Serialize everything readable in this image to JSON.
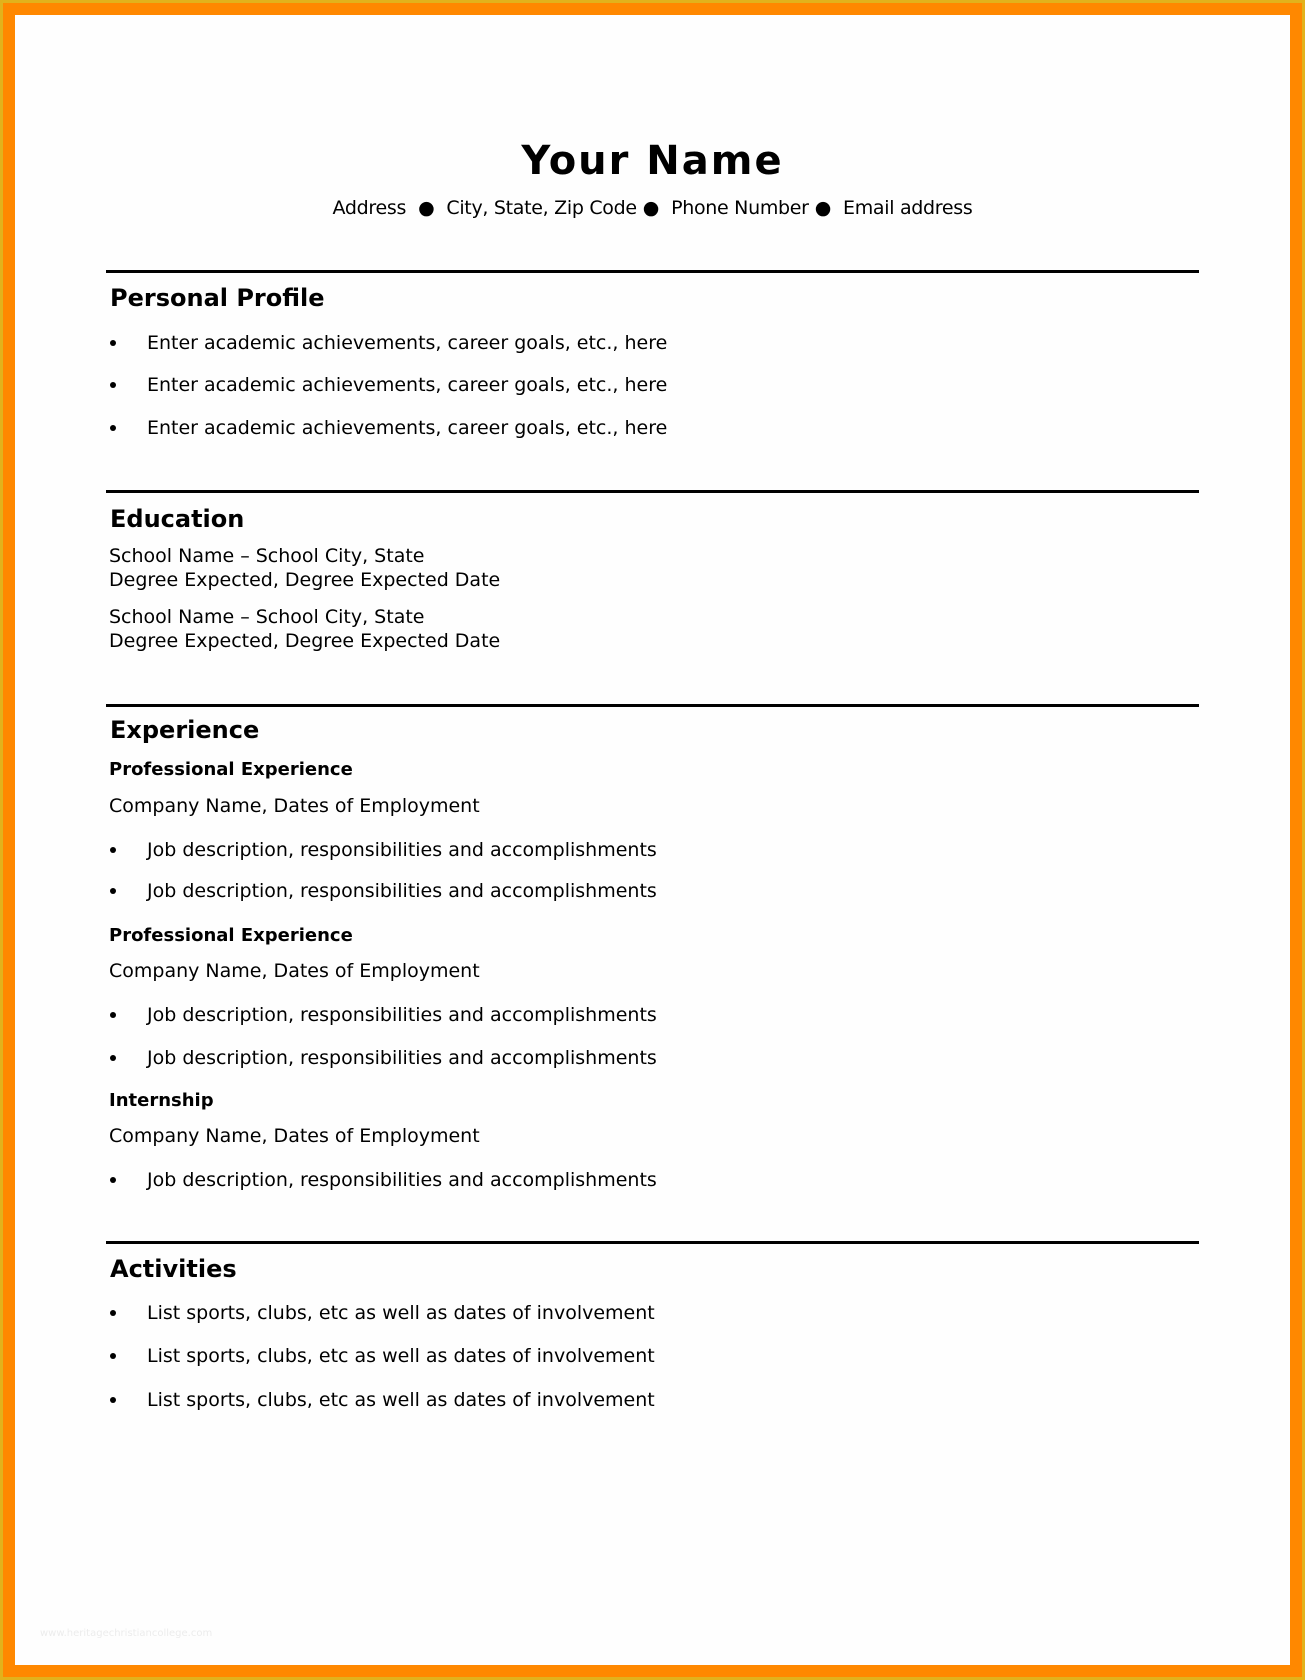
{
  "colors": {
    "border_outer": "#e2b21c",
    "border_inner": "#ff8800",
    "page": "#fefefe",
    "text": "#000000"
  },
  "header": {
    "name": "Your Name",
    "contact": [
      "Address",
      "City, State, Zip Code",
      "Phone Number",
      "Email address"
    ],
    "separator_icon": "●"
  },
  "personal_profile": {
    "title": "Personal Profile",
    "bullets": [
      "Enter academic achievements, career goals, etc., here",
      "Enter academic achievements, career goals, etc., here",
      "Enter academic achievements, career goals, etc., here"
    ]
  },
  "education": {
    "title": "Education",
    "entries": [
      {
        "school": "School Name – School City, State",
        "degree": "Degree Expected, Degree Expected Date"
      },
      {
        "school": "School Name – School City, State",
        "degree": "Degree Expected, Degree Expected Date"
      }
    ]
  },
  "experience": {
    "title": "Experience",
    "entries": [
      {
        "type": "Professional Experience",
        "company": "Company Name, Dates of Employment",
        "bullets": [
          "Job description, responsibilities and accomplishments",
          "Job description, responsibilities and accomplishments"
        ]
      },
      {
        "type": "Professional Experience",
        "company": "Company Name, Dates of Employment",
        "bullets": [
          "Job description, responsibilities and accomplishments",
          "Job description, responsibilities and accomplishments"
        ]
      },
      {
        "type": "Internship",
        "company": "Company Name, Dates of Employment",
        "bullets": [
          "Job description, responsibilities and accomplishments"
        ]
      }
    ]
  },
  "activities": {
    "title": "Activities",
    "bullets": [
      "List sports, clubs, etc as well as dates of involvement",
      "List sports, clubs, etc as well as dates of involvement",
      "List sports, clubs, etc as well as dates of involvement"
    ]
  },
  "watermark": "www.heritagechristiancollege.com"
}
